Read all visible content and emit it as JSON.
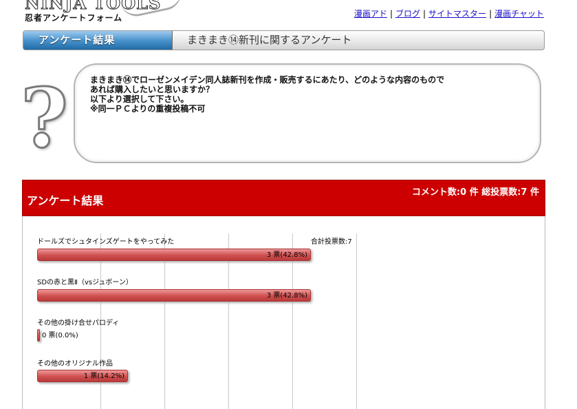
{
  "logo": {
    "main": "NINJA TOOLS",
    "sub": "忍者アンケートフォーム"
  },
  "toplinks": [
    "漫画アド",
    "ブログ",
    "サイトマスター",
    "漫画チャット"
  ],
  "titlebar": {
    "tab": "アンケート結果",
    "title": "まきまき⑭新刊に関するアンケート"
  },
  "question": {
    "lines": [
      "まきまき⑭でローゼンメイデン同人誌新刊を作成・販売するにあたり、どのような内容のもので",
      "あれば購入したいと思いますか？",
      "以下より選択して下さい。",
      "※同一ＰＣよりの重複投稿不可"
    ]
  },
  "results": {
    "title": "アンケート結果",
    "stats": "コメント数:0 件  総投票数:7 件",
    "total_label": "合計投票数:7",
    "options": [
      {
        "label": "ドールズでシュタインズゲートをやってみた",
        "votes": 3,
        "percent": 42.8,
        "vote_text": "3 票(42.8%)"
      },
      {
        "label": "SDの赤と黒Ⅱ（vsジュボーン）",
        "votes": 3,
        "percent": 42.8,
        "vote_text": "3 票(42.8%)"
      },
      {
        "label": "その他の掛け合せパロディ",
        "votes": 0,
        "percent": 0.0,
        "vote_text": "0 票(0.0%)"
      },
      {
        "label": "その他のオリジナル作品",
        "votes": 1,
        "percent": 14.2,
        "vote_text": "1 票(14.2%)"
      }
    ]
  },
  "colors": {
    "header_red": "#cc0000",
    "bar_red": "#d05050",
    "tab_blue": "#4b93cc",
    "link": "#1a10c8"
  }
}
